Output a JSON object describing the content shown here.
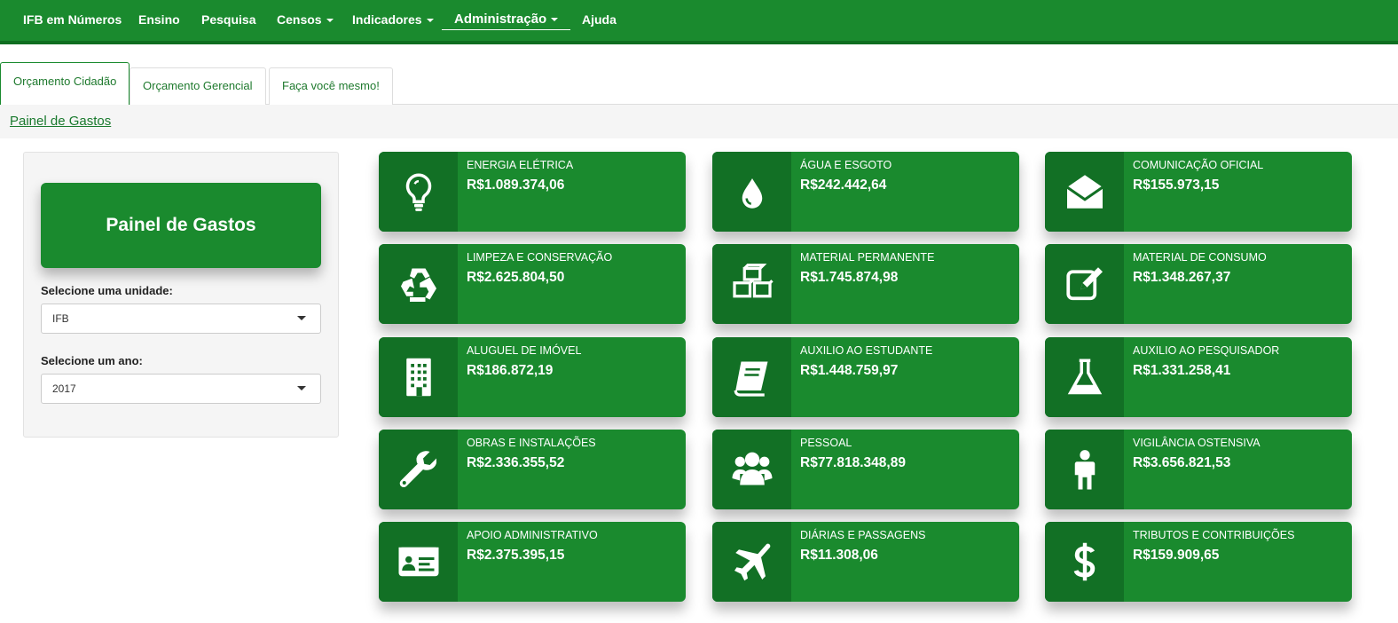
{
  "nav": {
    "brand": "IFB em Números",
    "items": [
      "Ensino",
      "Pesquisa",
      "Censos",
      "Indicadores",
      "Administração",
      "Ajuda"
    ],
    "active": "Administração"
  },
  "tabs": [
    "Orçamento Cidadão",
    "Orçamento Gerencial",
    "Faça você mesmo!"
  ],
  "active_tab": "Orçamento Cidadão",
  "breadcrumb": "Painel de Gastos",
  "panel": {
    "title": "Painel de Gastos",
    "unit_label": "Selecione uma unidade:",
    "unit_value": "IFB",
    "year_label": "Selecione um ano:",
    "year_value": "2017"
  },
  "colors": {
    "primary": "#1a8a2e",
    "icon_bg": "#127025",
    "nav_border": "#0f6e20"
  },
  "cards": [
    {
      "label": "ENERGIA ELÉTRICA",
      "value": "R$1.089.374,06",
      "icon": "lightbulb-icon"
    },
    {
      "label": "ÁGUA E ESGOTO",
      "value": "R$242.442,64",
      "icon": "water-drop-icon"
    },
    {
      "label": "COMUNICAÇÃO OFICIAL",
      "value": "R$155.973,15",
      "icon": "envelope-open-icon"
    },
    {
      "label": "LIMPEZA E CONSERVAÇÃO",
      "value": "R$2.625.804,50",
      "icon": "recycle-icon"
    },
    {
      "label": "MATERIAL PERMANENTE",
      "value": "R$1.745.874,98",
      "icon": "cubes-icon"
    },
    {
      "label": "MATERIAL DE CONSUMO",
      "value": "R$1.348.267,37",
      "icon": "edit-icon"
    },
    {
      "label": "ALUGUEL DE IMÓVEL",
      "value": "R$186.872,19",
      "icon": "building-icon"
    },
    {
      "label": "AUXILIO AO ESTUDANTE",
      "value": "R$1.448.759,97",
      "icon": "book-icon"
    },
    {
      "label": "AUXILIO AO PESQUISADOR",
      "value": "R$1.331.258,41",
      "icon": "flask-icon"
    },
    {
      "label": "OBRAS E INSTALAÇÕES",
      "value": "R$2.336.355,52",
      "icon": "wrench-icon"
    },
    {
      "label": "PESSOAL",
      "value": "R$77.818.348,89",
      "icon": "users-icon"
    },
    {
      "label": "VIGILÂNCIA OSTENSIVA",
      "value": "R$3.656.821,53",
      "icon": "male-icon"
    },
    {
      "label": "APOIO ADMINISTRATIVO",
      "value": "R$2.375.395,15",
      "icon": "id-card-icon"
    },
    {
      "label": "DIÁRIAS E PASSAGENS",
      "value": "R$11.308,06",
      "icon": "plane-icon"
    },
    {
      "label": "TRIBUTOS E CONTRIBUIÇÕES",
      "value": "R$159.909,65",
      "icon": "dollar-icon"
    }
  ]
}
